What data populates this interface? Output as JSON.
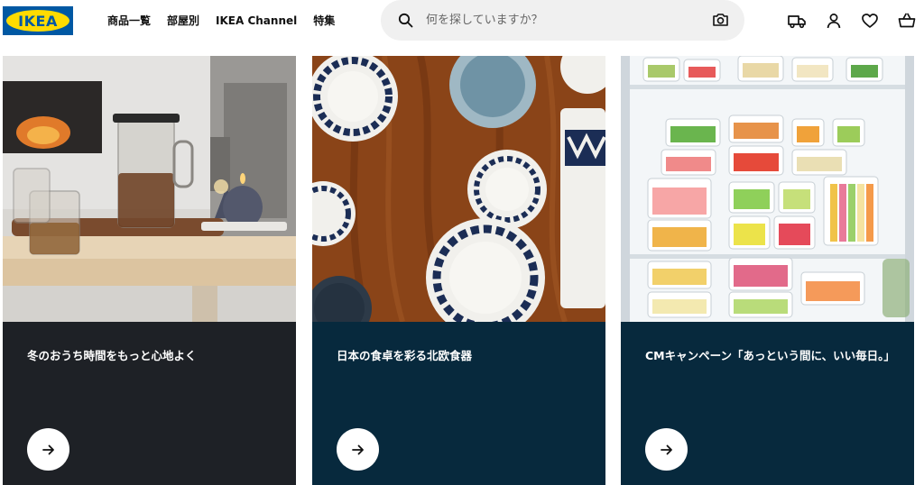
{
  "header": {
    "logo_text": "IKEA",
    "nav": [
      "商品一覧",
      "部屋別",
      "IKEA Channel",
      "特集"
    ],
    "search": {
      "placeholder": "何を探していますか？"
    },
    "icons": [
      "truck-icon",
      "user-icon",
      "heart-icon",
      "basket-icon"
    ]
  },
  "cards": [
    {
      "title": "冬のおうち時間をもっと心地よく",
      "panel_color": "#1e2126"
    },
    {
      "title": "日本の食卓を彩る北欧食器",
      "panel_color": "#07293d"
    },
    {
      "title": "CMキャンペーン「あっという間に、いい毎日。」",
      "panel_color": "#07293d"
    }
  ],
  "colors": {
    "brand_blue": "#0058a3",
    "brand_yellow": "#ffdb00"
  }
}
